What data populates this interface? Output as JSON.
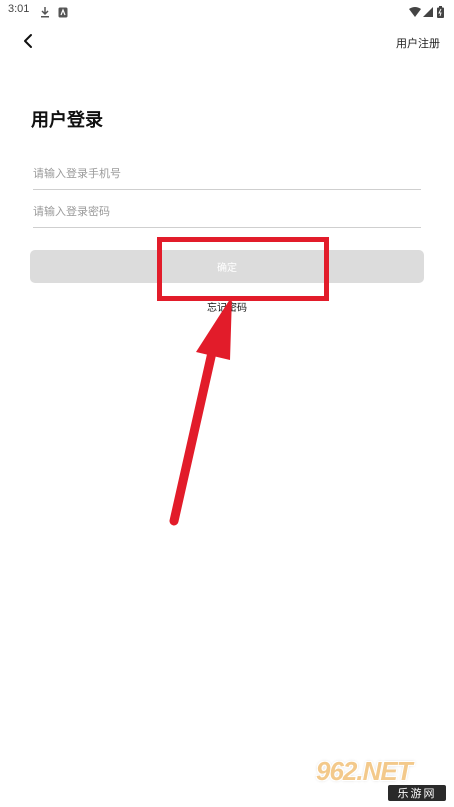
{
  "status_bar": {
    "time": "3:01",
    "icons": [
      "download-icon",
      "app-notification-icon",
      "wifi-icon",
      "signal-icon",
      "battery-icon"
    ]
  },
  "header": {
    "back_icon": "chevron-left-icon",
    "register_label": "用户注册"
  },
  "login": {
    "title": "用户登录",
    "phone_placeholder": "请输入登录手机号",
    "phone_value": "",
    "password_placeholder": "请输入登录密码",
    "password_value": "",
    "confirm_label": "确定",
    "forgot_label": "忘记密码"
  },
  "annotation": {
    "highlight_color": "#e21c2a"
  },
  "watermark": {
    "logo_text": "962.NET",
    "site_text": "乐游网"
  }
}
